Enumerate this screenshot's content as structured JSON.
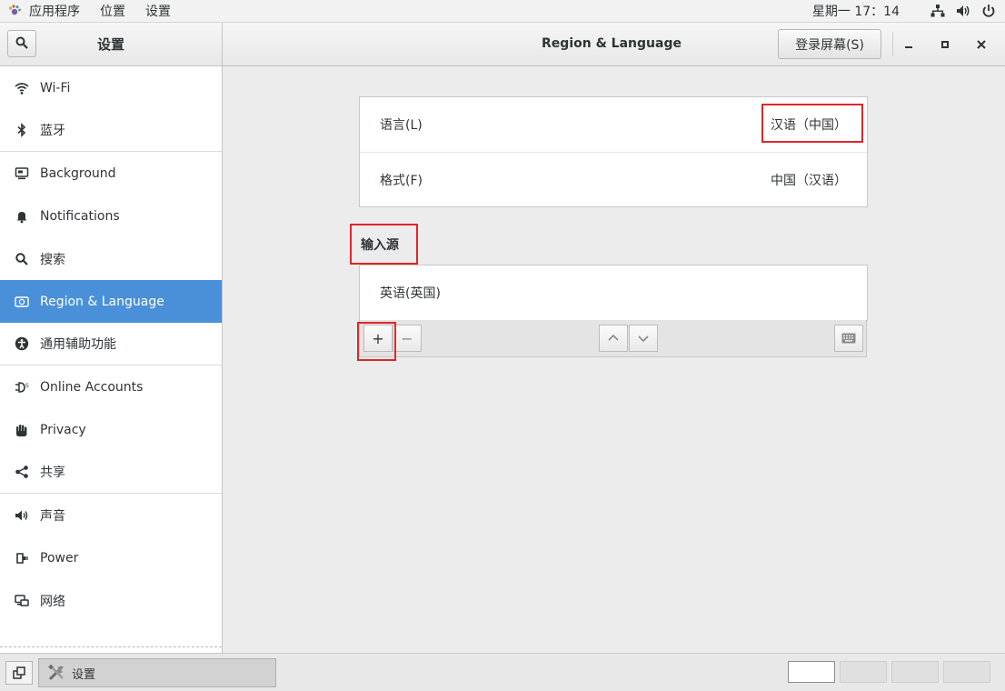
{
  "topbar": {
    "menus": [
      "应用程序",
      "位置",
      "设置"
    ],
    "clock": "星期一 17：14"
  },
  "header": {
    "sidebar_title": "设置",
    "title": "Region & Language",
    "login_button": "登录屏幕(S)"
  },
  "sidebar": {
    "items": [
      {
        "label": "Wi-Fi",
        "icon": "wifi-icon"
      },
      {
        "label": "蓝牙",
        "icon": "bluetooth-icon"
      },
      {
        "label": "Background",
        "icon": "background-icon"
      },
      {
        "label": "Notifications",
        "icon": "bell-icon"
      },
      {
        "label": "搜索",
        "icon": "search-icon"
      },
      {
        "label": "Region & Language",
        "icon": "region-icon",
        "selected": true
      },
      {
        "label": "通用辅助功能",
        "icon": "accessibility-icon"
      },
      {
        "label": "Online Accounts",
        "icon": "online-accounts-icon"
      },
      {
        "label": "Privacy",
        "icon": "privacy-hand-icon"
      },
      {
        "label": "共享",
        "icon": "share-icon"
      },
      {
        "label": "声音",
        "icon": "sound-icon"
      },
      {
        "label": "Power",
        "icon": "power-plug-icon"
      },
      {
        "label": "网络",
        "icon": "network-icon"
      }
    ]
  },
  "region": {
    "language_label": "语言(L)",
    "language_value": "汉语（中国）",
    "formats_label": "格式(F)",
    "formats_value": "中国（汉语）"
  },
  "input_sources": {
    "title": "输入源",
    "items": [
      "英语(英国)"
    ],
    "add_label": "+",
    "remove_label": "−"
  },
  "taskbar": {
    "task_label": "设置"
  },
  "colors": {
    "accent": "#4a90d9",
    "highlight_box": "#e0262a"
  }
}
